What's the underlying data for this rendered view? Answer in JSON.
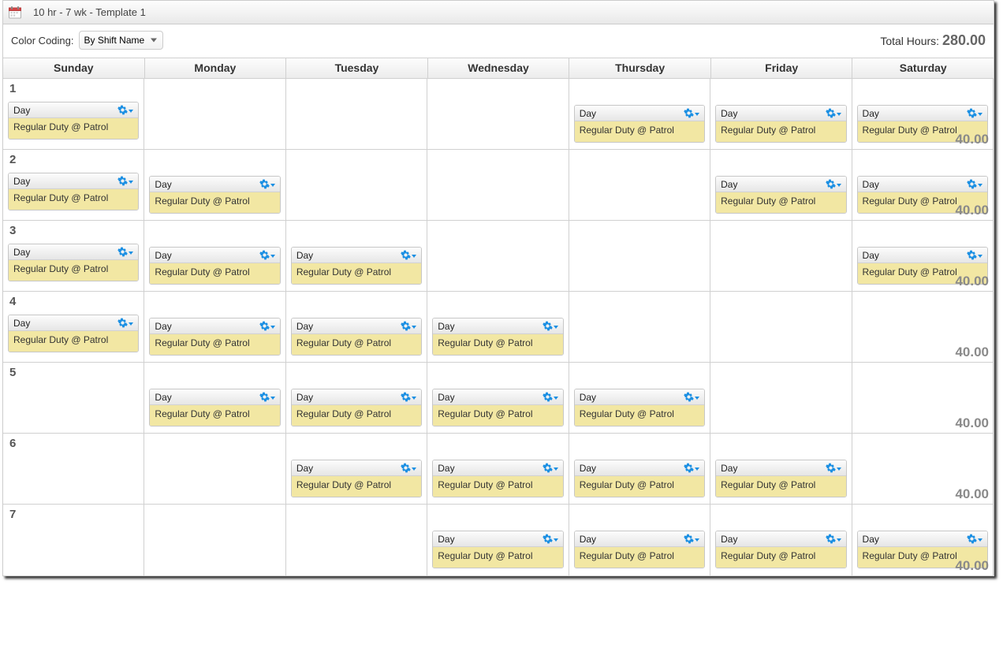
{
  "header": {
    "title": "10 hr - 7 wk - Template 1"
  },
  "toolbar": {
    "color_coding_label": "Color Coding:",
    "color_coding_value": "By Shift Name",
    "total_label": "Total Hours: ",
    "total_value": "280.00"
  },
  "days": [
    "Sunday",
    "Monday",
    "Tuesday",
    "Wednesday",
    "Thursday",
    "Friday",
    "Saturday"
  ],
  "shift": {
    "name": "Day",
    "detail": "Regular Duty @ Patrol"
  },
  "weeks": [
    {
      "num": "1",
      "total": "40.00",
      "cells": [
        true,
        false,
        false,
        false,
        true,
        true,
        true
      ]
    },
    {
      "num": "2",
      "total": "40.00",
      "cells": [
        true,
        true,
        false,
        false,
        false,
        true,
        true
      ]
    },
    {
      "num": "3",
      "total": "40.00",
      "cells": [
        true,
        true,
        true,
        false,
        false,
        false,
        true
      ]
    },
    {
      "num": "4",
      "total": "40.00",
      "cells": [
        true,
        true,
        true,
        true,
        false,
        false,
        false
      ]
    },
    {
      "num": "5",
      "total": "40.00",
      "cells": [
        false,
        true,
        true,
        true,
        true,
        false,
        false
      ]
    },
    {
      "num": "6",
      "total": "40.00",
      "cells": [
        false,
        false,
        true,
        true,
        true,
        true,
        false
      ]
    },
    {
      "num": "7",
      "total": "40.00",
      "cells": [
        false,
        false,
        false,
        true,
        true,
        true,
        true
      ]
    }
  ]
}
